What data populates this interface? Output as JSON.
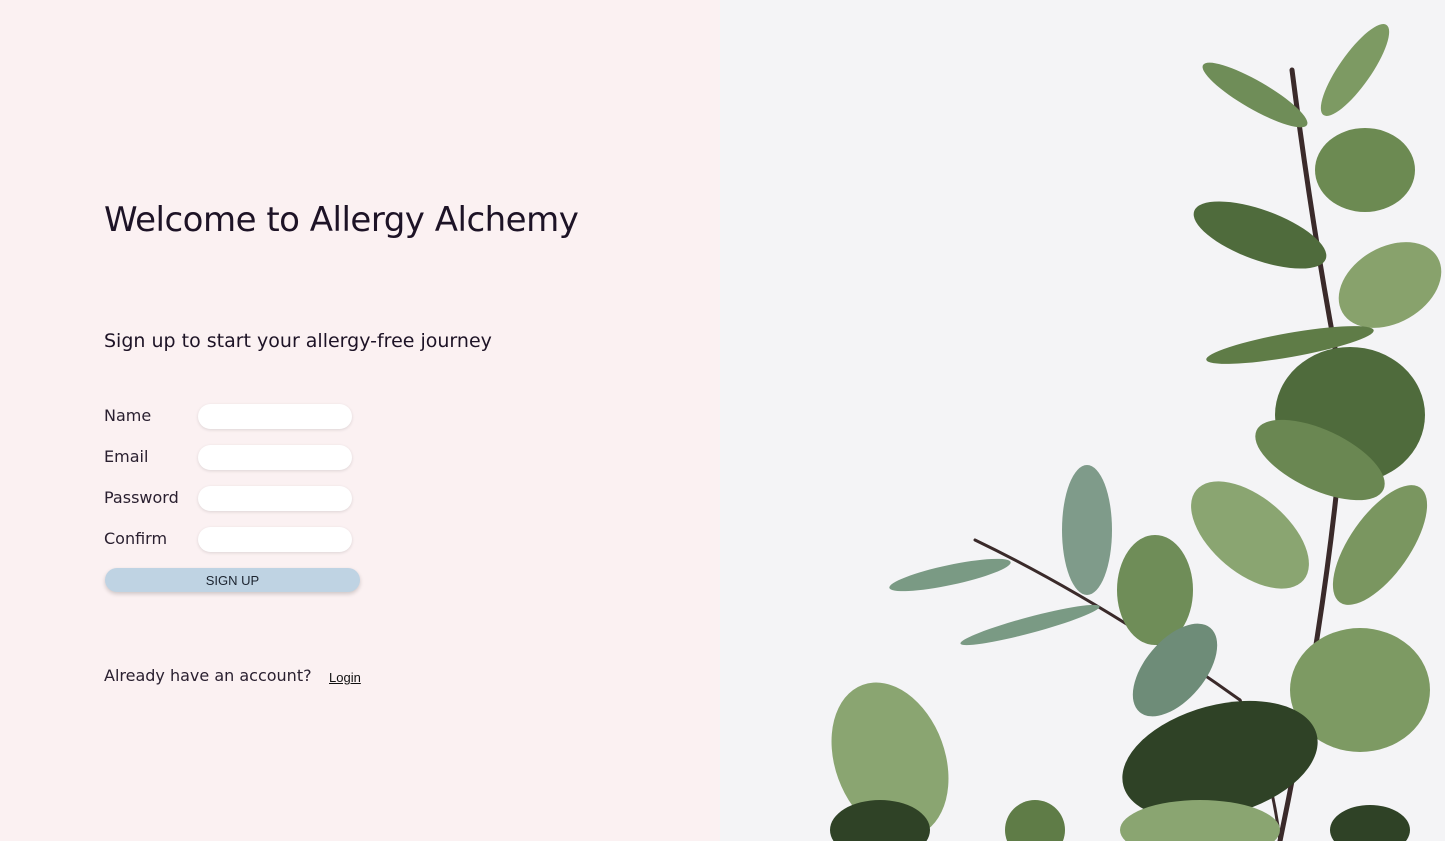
{
  "header": {
    "title": "Welcome to Allergy Alchemy"
  },
  "signup_form": {
    "subtitle": "Sign up to start your allergy-free journey",
    "fields": [
      {
        "label": "Name",
        "value": "",
        "placeholder": "",
        "type": "text"
      },
      {
        "label": "Email",
        "value": "",
        "placeholder": "",
        "type": "email"
      },
      {
        "label": "Password",
        "value": "",
        "placeholder": "",
        "type": "password"
      },
      {
        "label": "Confirm",
        "value": "",
        "placeholder": "",
        "type": "password"
      }
    ],
    "submit_label": "SIGN UP"
  },
  "footer": {
    "prompt": "Already have an account?",
    "login_link": "Login"
  },
  "decor": {
    "image_subject": "eucalyptus-branch-icon"
  },
  "colors": {
    "left_background": "#fbf1f2",
    "right_background": "#f4f4f6",
    "button": "#bfd3e3",
    "text": "#1d1326",
    "leaf_dark": "#4f6b3c",
    "leaf_light": "#8aa571",
    "stem": "#3a2a2a"
  }
}
